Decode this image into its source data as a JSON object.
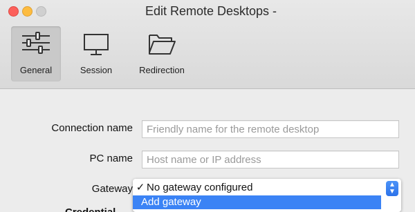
{
  "window": {
    "title": "Edit Remote Desktops -"
  },
  "toolbar": {
    "items": [
      {
        "label": "General",
        "icon": "sliders-icon",
        "selected": true
      },
      {
        "label": "Session",
        "icon": "monitor-icon",
        "selected": false
      },
      {
        "label": "Redirection",
        "icon": "folder-icon",
        "selected": false
      }
    ]
  },
  "form": {
    "connection_name": {
      "label": "Connection name",
      "value": "",
      "placeholder": "Friendly name for the remote desktop"
    },
    "pc_name": {
      "label": "PC name",
      "value": "",
      "placeholder": "Host name or IP address"
    },
    "gateway": {
      "label": "Gateway",
      "options": [
        {
          "label": "No gateway configured",
          "checked": true
        },
        {
          "label": "Add gateway",
          "highlighted": true
        }
      ]
    },
    "credentials_label_partial": "Credential"
  },
  "colors": {
    "highlight": "#3b83f5",
    "toolbar_bg": "#dedede",
    "content_bg": "#ececec"
  }
}
